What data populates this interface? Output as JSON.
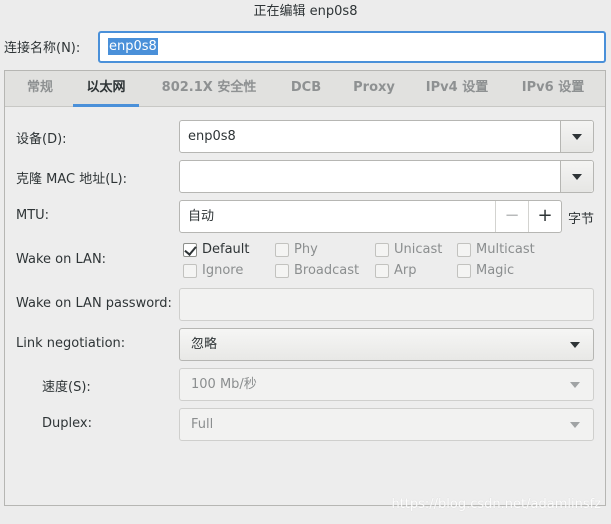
{
  "window": {
    "title": "正在编辑 enp0s8"
  },
  "connection": {
    "label": "连接名称(N):",
    "value": "enp0s8"
  },
  "tabs": [
    {
      "label": "常规"
    },
    {
      "label": "以太网"
    },
    {
      "label": "802.1X 安全性"
    },
    {
      "label": "DCB"
    },
    {
      "label": "Proxy"
    },
    {
      "label": "IPv4 设置"
    },
    {
      "label": "IPv6 设置"
    }
  ],
  "active_tab": "以太网",
  "form": {
    "device": {
      "label": "设备(D):",
      "value": "enp0s8"
    },
    "cloned_mac": {
      "label": "克隆 MAC 地址(L):",
      "value": ""
    },
    "mtu": {
      "label": "MTU:",
      "value": "自动",
      "minus": "−",
      "plus": "+",
      "unit": "字节"
    },
    "wol": {
      "label": "Wake on LAN:",
      "options": [
        {
          "label": "Default",
          "checked": true
        },
        {
          "label": "Phy",
          "checked": false
        },
        {
          "label": "Unicast",
          "checked": false
        },
        {
          "label": "Multicast",
          "checked": false
        },
        {
          "label": "Ignore",
          "checked": false
        },
        {
          "label": "Broadcast",
          "checked": false
        },
        {
          "label": "Arp",
          "checked": false
        },
        {
          "label": "Magic",
          "checked": false
        }
      ]
    },
    "wol_password": {
      "label": "Wake on LAN password:",
      "value": ""
    },
    "link_negotiation": {
      "label": "Link negotiation:",
      "value": "忽略"
    },
    "speed": {
      "label": "速度(S):",
      "value": "100 Mb/秒"
    },
    "duplex": {
      "label": "Duplex:",
      "value": "Full"
    }
  },
  "watermark": "https://blog.csdn.net/adamlinsfz",
  "colors": {
    "accent": "#4a90d9",
    "background": "#ececec"
  },
  "icons": {
    "dropdown": "chevron-down-icon",
    "checkbox": "checkmark-icon"
  }
}
